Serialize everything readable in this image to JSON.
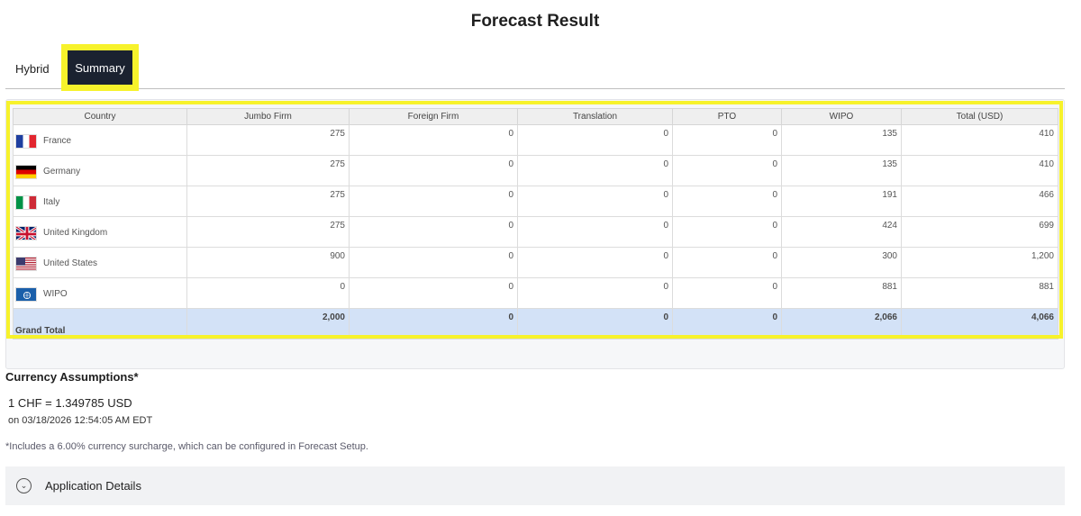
{
  "page": {
    "title": "Forecast Result"
  },
  "tabs": [
    {
      "label": "Hybrid",
      "active": false
    },
    {
      "label": "Summary",
      "active": true
    }
  ],
  "table": {
    "headers": [
      "Country",
      "Jumbo Firm",
      "Foreign Firm",
      "Translation",
      "PTO",
      "WIPO",
      "Total (USD)"
    ],
    "rows": [
      {
        "country": "France",
        "flag": "fr-flag-icon",
        "jumbo": "275",
        "foreign": "0",
        "translation": "0",
        "pto": "0",
        "wipo": "135",
        "total": "410"
      },
      {
        "country": "Germany",
        "flag": "de-flag-icon",
        "jumbo": "275",
        "foreign": "0",
        "translation": "0",
        "pto": "0",
        "wipo": "135",
        "total": "410"
      },
      {
        "country": "Italy",
        "flag": "it-flag-icon",
        "jumbo": "275",
        "foreign": "0",
        "translation": "0",
        "pto": "0",
        "wipo": "191",
        "total": "466"
      },
      {
        "country": "United Kingdom",
        "flag": "uk-flag-icon",
        "jumbo": "275",
        "foreign": "0",
        "translation": "0",
        "pto": "0",
        "wipo": "424",
        "total": "699"
      },
      {
        "country": "United States",
        "flag": "us-flag-icon",
        "jumbo": "900",
        "foreign": "0",
        "translation": "0",
        "pto": "0",
        "wipo": "300",
        "total": "1,200"
      },
      {
        "country": "WIPO",
        "flag": "wipo-flag-icon",
        "jumbo": "0",
        "foreign": "0",
        "translation": "0",
        "pto": "0",
        "wipo": "881",
        "total": "881"
      }
    ],
    "grand_total": {
      "label": "Grand Total",
      "jumbo": "2,000",
      "foreign": "0",
      "translation": "0",
      "pto": "0",
      "wipo": "2,066",
      "total": "4,066"
    }
  },
  "currency": {
    "title": "Currency Assumptions*",
    "rate": "1 CHF = 1.349785 USD",
    "date": "on 03/18/2026 12:54:05 AM EDT",
    "note": "*Includes a 6.00% currency surcharge, which can be configured in Forecast Setup."
  },
  "app_details": {
    "label": "Application Details",
    "icon": "chevron-down-icon"
  },
  "colors": {
    "highlight": "#f7f22b",
    "active_tab": "#1b2230",
    "grand_total_bg": "#d3e2f7"
  }
}
